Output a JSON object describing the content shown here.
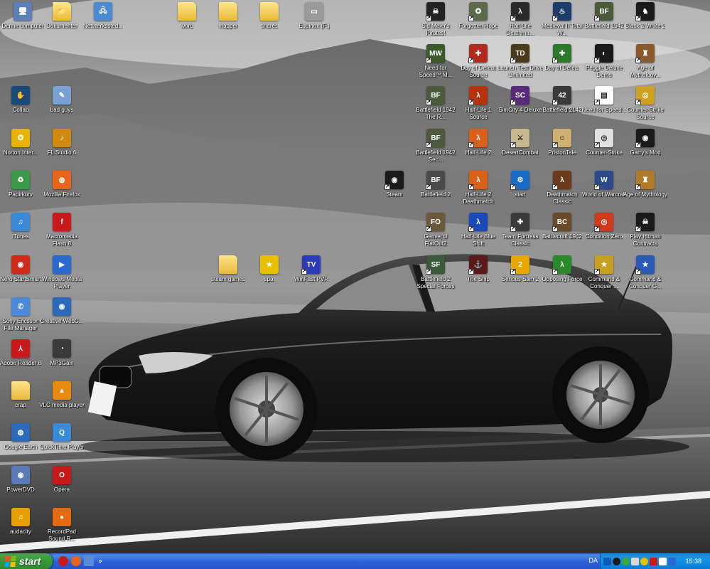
{
  "desktop": {
    "icons": [
      {
        "label": "Denne computer",
        "glyph": "🖥",
        "color": "#5b7fb8"
      },
      {
        "label": "Dokumenter",
        "glyph": "📁",
        "color": "#e5b94a",
        "folder": true
      },
      {
        "label": "Netværkssted...",
        "glyph": "🖧",
        "color": "#4a8ad0"
      },
      {
        "label": "word",
        "glyph": "",
        "color": "#e5b94a",
        "folder": true
      },
      {
        "label": "mapper",
        "glyph": "",
        "color": "#e5b94a",
        "folder": true
      },
      {
        "label": "shares",
        "glyph": "",
        "color": "#e5b94a",
        "folder": true
      },
      {
        "label": "Equinox (F:)",
        "glyph": "▭",
        "color": "#9a9a9a"
      },
      {
        "label": "Sid Meier's Pirates!",
        "glyph": "☠",
        "color": "#222222",
        "shortcut": true
      },
      {
        "label": "Forgotten Hope",
        "glyph": "✪",
        "color": "#5a6a4a",
        "shortcut": true
      },
      {
        "label": "Half-Life Deathma...",
        "glyph": "λ",
        "color": "#2a2a2a",
        "shortcut": true
      },
      {
        "label": "Medieval II Total W...",
        "glyph": "♨",
        "color": "#1c3c6a",
        "shortcut": true
      },
      {
        "label": "Battlefield 1942",
        "glyph": "BF",
        "color": "#4a5a3a",
        "shortcut": true
      },
      {
        "label": "Black & White 2",
        "glyph": "♞",
        "color": "#1a1a1a",
        "shortcut": true
      },
      {
        "label": "Need for Speed™ M...",
        "glyph": "MW",
        "color": "#3a5a2a",
        "shortcut": true
      },
      {
        "label": "Day of Defeat Source",
        "glyph": "✚",
        "color": "#b22a1e",
        "shortcut": true
      },
      {
        "label": "Launch Test Drive Unlimited",
        "glyph": "TD",
        "color": "#4a3a1a",
        "shortcut": true
      },
      {
        "label": "Day of Defeat",
        "glyph": "✚",
        "color": "#2a7a2a",
        "shortcut": true
      },
      {
        "label": "Peggle Deluxe Demo",
        "glyph": "◐",
        "color": "#1a1a1a",
        "shortcut": true
      },
      {
        "label": "Age of Mythology...",
        "glyph": "♜",
        "color": "#8a5a2a",
        "shortcut": true
      },
      {
        "label": "Collab",
        "glyph": "✋",
        "color": "#1a4a7a"
      },
      {
        "label": "bad guys",
        "glyph": "✎",
        "color": "#7aa0d0"
      },
      {
        "label": "Battlefield 1942 The R...",
        "glyph": "BF",
        "color": "#4a5a3a",
        "shortcut": true
      },
      {
        "label": "Half-Life 1 Source",
        "glyph": "λ",
        "color": "#b8320e",
        "shortcut": true
      },
      {
        "label": "SimCity 4 Deluxe",
        "glyph": "SC",
        "color": "#5a2a7a",
        "shortcut": true
      },
      {
        "label": "Battlefield 2142",
        "glyph": "42",
        "color": "#3a3a3a",
        "shortcut": true
      },
      {
        "label": "Need for Speed...",
        "glyph": "▤",
        "color": "#ffffff",
        "shortcut": true
      },
      {
        "label": "Counter-Strike Source",
        "glyph": "◎",
        "color": "#d0a020",
        "shortcut": true
      },
      {
        "label": "Norton Inter...",
        "glyph": "✪",
        "color": "#e8b400"
      },
      {
        "label": "FL Studio 6",
        "glyph": "♪",
        "color": "#d08a10"
      },
      {
        "label": "Battlefield 1942 Sec...",
        "glyph": "BF",
        "color": "#4a5a3a",
        "shortcut": true
      },
      {
        "label": "Half-Life 2",
        "glyph": "λ",
        "color": "#d8601a",
        "shortcut": true
      },
      {
        "label": "DesertCombat",
        "glyph": "⚔",
        "color": "#c8b890",
        "shortcut": true
      },
      {
        "label": "PristonTale",
        "glyph": "☺",
        "color": "#d0b070",
        "shortcut": true
      },
      {
        "label": "Counter-Strike",
        "glyph": "◎",
        "color": "#e0e0e0",
        "shortcut": true
      },
      {
        "label": "Garry's Mod",
        "glyph": "◉",
        "color": "#1a1a1a",
        "shortcut": true
      },
      {
        "label": "Papirkurv",
        "glyph": "♻",
        "color": "#3a9a4a"
      },
      {
        "label": "Mozilla Firefox",
        "glyph": "◍",
        "color": "#e8641a"
      },
      {
        "label": "Steam",
        "glyph": "◉",
        "color": "#1a1a1a",
        "shortcut": true
      },
      {
        "label": "Battlefield 2",
        "glyph": "BF",
        "color": "#4a4a4a",
        "shortcut": true
      },
      {
        "label": "Half-Life 2 Deathmatch",
        "glyph": "λ",
        "color": "#d8601a",
        "shortcut": true
      },
      {
        "label": "start",
        "glyph": "⚙",
        "color": "#1a6ac8",
        "shortcut": true
      },
      {
        "label": "Deathmatch Classic",
        "glyph": "λ",
        "color": "#6a3a1a",
        "shortcut": true
      },
      {
        "label": "World of Warcraft",
        "glyph": "W",
        "color": "#2a4a8a",
        "shortcut": true
      },
      {
        "label": "Age of Mythology",
        "glyph": "♜",
        "color": "#b07a2a",
        "shortcut": true
      },
      {
        "label": "iTunes",
        "glyph": "♫",
        "color": "#3a8ad8"
      },
      {
        "label": "Macromedia Flash 8",
        "glyph": "f",
        "color": "#c81a1a"
      },
      {
        "label": "Genvej til FlatOut2",
        "glyph": "FO",
        "color": "#6a5a3a",
        "shortcut": true
      },
      {
        "label": "Half-Life Blue Shift",
        "glyph": "λ",
        "color": "#1a4ab8",
        "shortcut": true
      },
      {
        "label": "Team Fortress Classic",
        "glyph": "✚",
        "color": "#3a3a3a",
        "shortcut": true
      },
      {
        "label": "Battlecraft 1942",
        "glyph": "BC",
        "color": "#6a4a2a",
        "shortcut": true
      },
      {
        "label": "Condition Zero",
        "glyph": "◎",
        "color": "#d03a1a",
        "shortcut": true
      },
      {
        "label": "Play Hitman Contracts",
        "glyph": "☠",
        "color": "#1a1a1a",
        "shortcut": true
      },
      {
        "label": "Nero StartSmart",
        "glyph": "◉",
        "color": "#d02a1a"
      },
      {
        "label": "Windows Media Player",
        "glyph": "▶",
        "color": "#2a6ad0"
      },
      {
        "label": "steam games",
        "glyph": "",
        "color": "#e5b94a",
        "folder": true
      },
      {
        "label": "spal",
        "glyph": "★",
        "color": "#e8c000"
      },
      {
        "label": "WinFast PVR",
        "glyph": "TV",
        "color": "#2a3ab8",
        "shortcut": true
      },
      {
        "label": "Battlefield 2 Special Forces",
        "glyph": "SF",
        "color": "#3a5a3a",
        "shortcut": true
      },
      {
        "label": "The Ship",
        "glyph": "⚓",
        "color": "#5a1a1a",
        "shortcut": true
      },
      {
        "label": "Serious Sam 2",
        "glyph": "2",
        "color": "#e8a800",
        "shortcut": true
      },
      {
        "label": "Opposing Force",
        "glyph": "λ",
        "color": "#2a8a2a",
        "shortcut": true
      },
      {
        "label": "Command & Conquer ...",
        "glyph": "★",
        "color": "#c8a020",
        "shortcut": true
      },
      {
        "label": "Command & Conquer G...",
        "glyph": "★",
        "color": "#2a5ab8",
        "shortcut": true
      },
      {
        "label": "Sony Ericsson File Manager",
        "glyph": "✆",
        "color": "#4a8ad8"
      },
      {
        "label": "Creative WebC...",
        "glyph": "◉",
        "color": "#2a6ab8"
      },
      {
        "label": "Adobe Reader 8",
        "glyph": "⅄",
        "color": "#c81a1a"
      },
      {
        "label": "MP3Gain",
        "glyph": "◔",
        "color": "#3a3a3a"
      },
      {
        "label": "crap",
        "glyph": "",
        "color": "#e5b94a",
        "folder": true
      },
      {
        "label": "VLC media player",
        "glyph": "▲",
        "color": "#e88a10"
      },
      {
        "label": "Google Earth",
        "glyph": "◍",
        "color": "#2a6ab8"
      },
      {
        "label": "QuickTime Player",
        "glyph": "Q",
        "color": "#3a8ad8"
      },
      {
        "label": "PowerDVD",
        "glyph": "◉",
        "color": "#5a7ab8"
      },
      {
        "label": "Opera",
        "glyph": "O",
        "color": "#c81a1a"
      },
      {
        "label": "audacity",
        "glyph": "♫",
        "color": "#e8a000"
      },
      {
        "label": "RecordPad Sound R...",
        "glyph": "●",
        "color": "#e86a10"
      }
    ]
  },
  "taskbar": {
    "start_label": "start",
    "language": "DA",
    "clock": "15:38",
    "quick_launch_more": "»"
  },
  "colors": {
    "taskbar_blue": "#2553c9",
    "start_green": "#3c9a3c",
    "tray_blue": "#0f8ce6"
  }
}
